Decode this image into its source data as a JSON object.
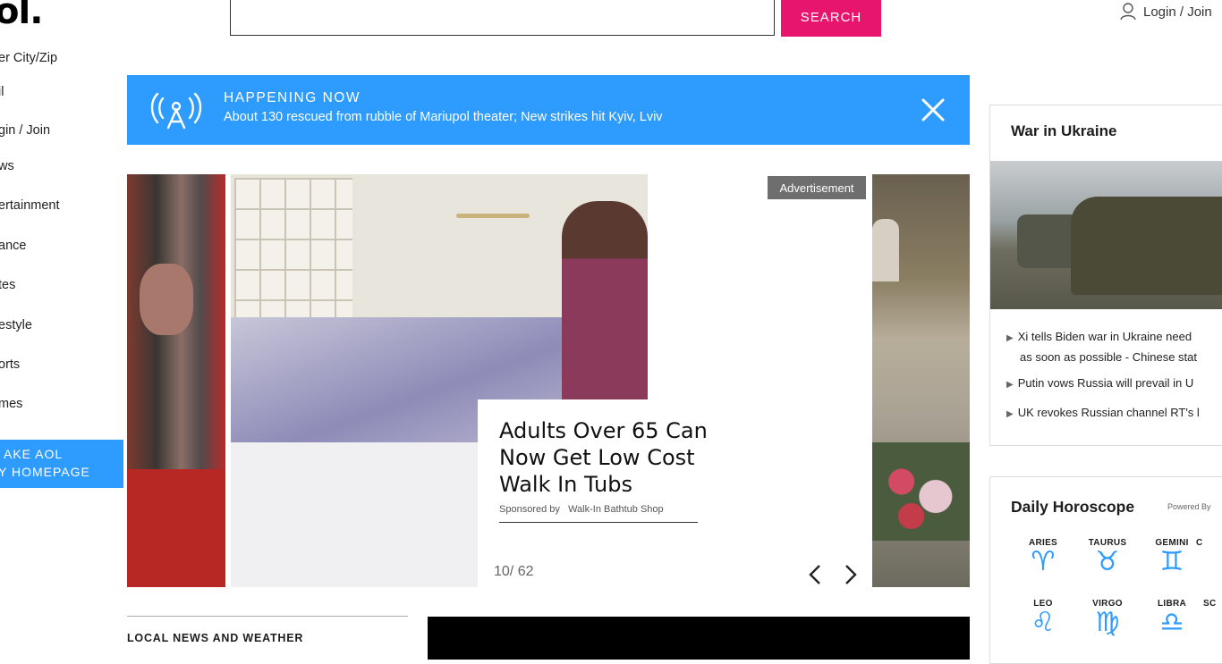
{
  "header": {
    "logo": "ol.",
    "search_placeholder": "",
    "search_button": "SEARCH",
    "login_label": "Login / Join"
  },
  "nav": {
    "items": [
      {
        "label": "er City/Zip",
        "icon": "location-icon"
      },
      {
        "label": "il",
        "icon": "mail-icon"
      },
      {
        "label": "gin / Join",
        "icon": "user-icon"
      },
      {
        "label": "ws",
        "icon": "news-icon"
      },
      {
        "label": "ertainment",
        "icon": "entertainment-icon"
      },
      {
        "label": "ance",
        "icon": "finance-icon"
      },
      {
        "label": "tes",
        "icon": "notes-icon"
      },
      {
        "label": "estyle",
        "icon": "lifestyle-icon"
      },
      {
        "label": "orts",
        "icon": "sports-icon"
      },
      {
        "label": "mes",
        "icon": "games-icon"
      }
    ],
    "make_aol_line1": "AKE AOL",
    "make_aol_line2": "Y HOMEPAGE"
  },
  "happening_now": {
    "title": "HAPPENING NOW",
    "text": "About 130 rescued from rubble of Mariupol theater; New strikes hit Kyiv, Lviv",
    "icon": "broadcast-tower-icon"
  },
  "slideshow": {
    "ad_label": "Advertisement",
    "caption_title": "Adults Over 65 Can Now Get Low Cost Walk In Tubs",
    "sponsored_prefix": "Sponsored by",
    "sponsor": "Walk-In Bathtub Shop",
    "counter": "10/ 62"
  },
  "local": {
    "title": "LOCAL NEWS AND WEATHER"
  },
  "war": {
    "title": "War in Ukraine",
    "items": [
      {
        "line1": "Xi tells Biden war in Ukraine need",
        "line2": "as soon as possible - Chinese stat"
      },
      {
        "line1": "Putin vows Russia will prevail in U",
        "line2": ""
      },
      {
        "line1": "UK revokes Russian channel RT's l",
        "line2": ""
      }
    ]
  },
  "horoscope": {
    "title": "Daily Horoscope",
    "powered": "Powered By",
    "signs_row1": [
      {
        "name": "ARIES",
        "glyph": "♈"
      },
      {
        "name": "TAURUS",
        "glyph": "♉"
      },
      {
        "name": "GEMINI",
        "glyph": "♊"
      },
      {
        "name": "C",
        "glyph": ""
      }
    ],
    "signs_row2": [
      {
        "name": "LEO",
        "glyph": "♌"
      },
      {
        "name": "VIRGO",
        "glyph": "♍"
      },
      {
        "name": "LIBRA",
        "glyph": "♎"
      },
      {
        "name": "SC",
        "glyph": ""
      }
    ]
  },
  "colors": {
    "accent_blue": "#2e9bff",
    "search_pink": "#e8156e"
  }
}
